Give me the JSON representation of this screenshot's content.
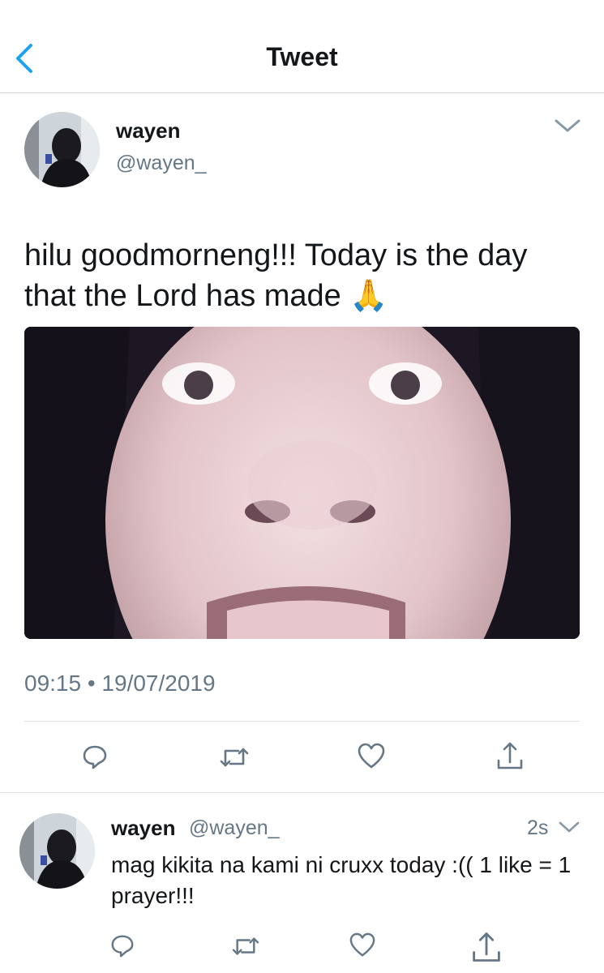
{
  "navbar": {
    "title": "Tweet"
  },
  "tweet": {
    "display_name": "wayen",
    "handle": "@wayen_",
    "text": "hilu goodmorneng!!! Today is the day that the Lord has made",
    "emoji": "🙏",
    "timestamp": "09:15 • 19/07/2019",
    "media": "photo-closeup-face"
  },
  "reply": {
    "display_name": "wayen",
    "handle": "@wayen_",
    "time_ago": "2s",
    "text": "mag kikita na kami ni cruxx today :(( 1 like = 1 prayer!!!"
  },
  "icons": {
    "back": "chevron-left-icon",
    "more": "chevron-down-icon",
    "reply": "comment-icon",
    "retweet": "retweet-icon",
    "like": "heart-icon",
    "share": "share-icon"
  },
  "colors": {
    "accent": "#1da1f2",
    "text": "#14171a",
    "secondary": "#657786",
    "icon": "#657786",
    "divider": "#dde3e8"
  }
}
